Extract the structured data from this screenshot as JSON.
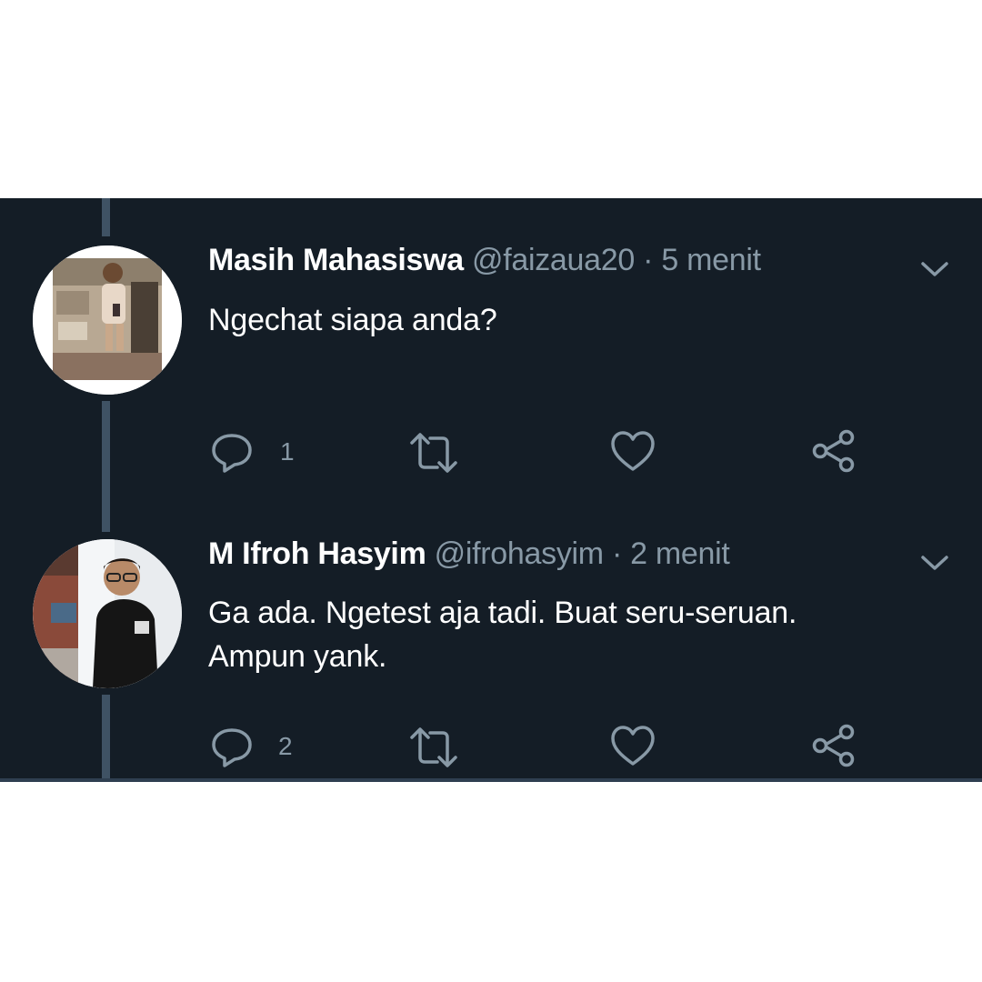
{
  "colors": {
    "background": "#141d26",
    "text_primary": "#ffffff",
    "text_secondary": "#8899a6",
    "thread_line": "#3f5264"
  },
  "tweets": [
    {
      "display_name": "Masih Mahasiswa",
      "handle": "@faizaua20",
      "separator": "·",
      "time": "5 menit",
      "text_lines": [
        "Ngechat siapa anda?"
      ],
      "reply_count": "1",
      "icons": [
        "reply-icon",
        "retweet-icon",
        "like-icon",
        "share-icon",
        "chevron-down-icon"
      ]
    },
    {
      "display_name": "M Ifroh Hasyim",
      "handle": "@ifrohasyim",
      "separator": "·",
      "time": "2 menit",
      "text_lines": [
        "Ga ada. Ngetest aja tadi. Buat seru-seruan.",
        "Ampun yank."
      ],
      "reply_count": "2",
      "icons": [
        "reply-icon",
        "retweet-icon",
        "like-icon",
        "share-icon",
        "chevron-down-icon"
      ]
    }
  ]
}
